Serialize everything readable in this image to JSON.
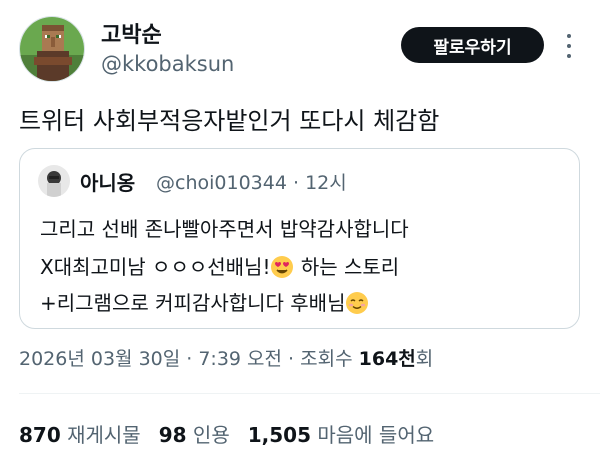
{
  "author": {
    "display_name": "고박순",
    "handle": "@kkobaksun",
    "avatar": "villager-pixel-avatar"
  },
  "follow_button_label": "팔로우하기",
  "more_icon": "more-vertical-icon",
  "tweet_text": "트위터 사회부적응자밭인거 또다시 체감함",
  "quote": {
    "display_name": "아니옹",
    "handle": "@choi010344",
    "separator": "·",
    "time": "12시",
    "line1": "그리고 선배 존나빨아주면서 밥약감사합니다",
    "line2_before": "X대최고미남 ㅇㅇㅇ선배님!",
    "line2_after": " 하는 스토리",
    "line3": "+리그램으로 커피감사합니다 후배님",
    "emoji_1": "heart-eyes-emoji",
    "emoji_2": "smiling-blush-emoji"
  },
  "meta": {
    "date_time": "2026년 03월 30일 · 7:39 오전 · 조회수 ",
    "views": "164천",
    "views_suffix": "회"
  },
  "stats": {
    "retweets_count": "870",
    "retweets_label": "재게시물",
    "quotes_count": "98",
    "quotes_label": "인용",
    "likes_count": "1,505",
    "likes_label": "마음에 들어요"
  },
  "colors": {
    "text_primary": "#0f1419",
    "text_secondary": "#536471",
    "border": "#cfd9de",
    "button_bg": "#0f1419"
  }
}
